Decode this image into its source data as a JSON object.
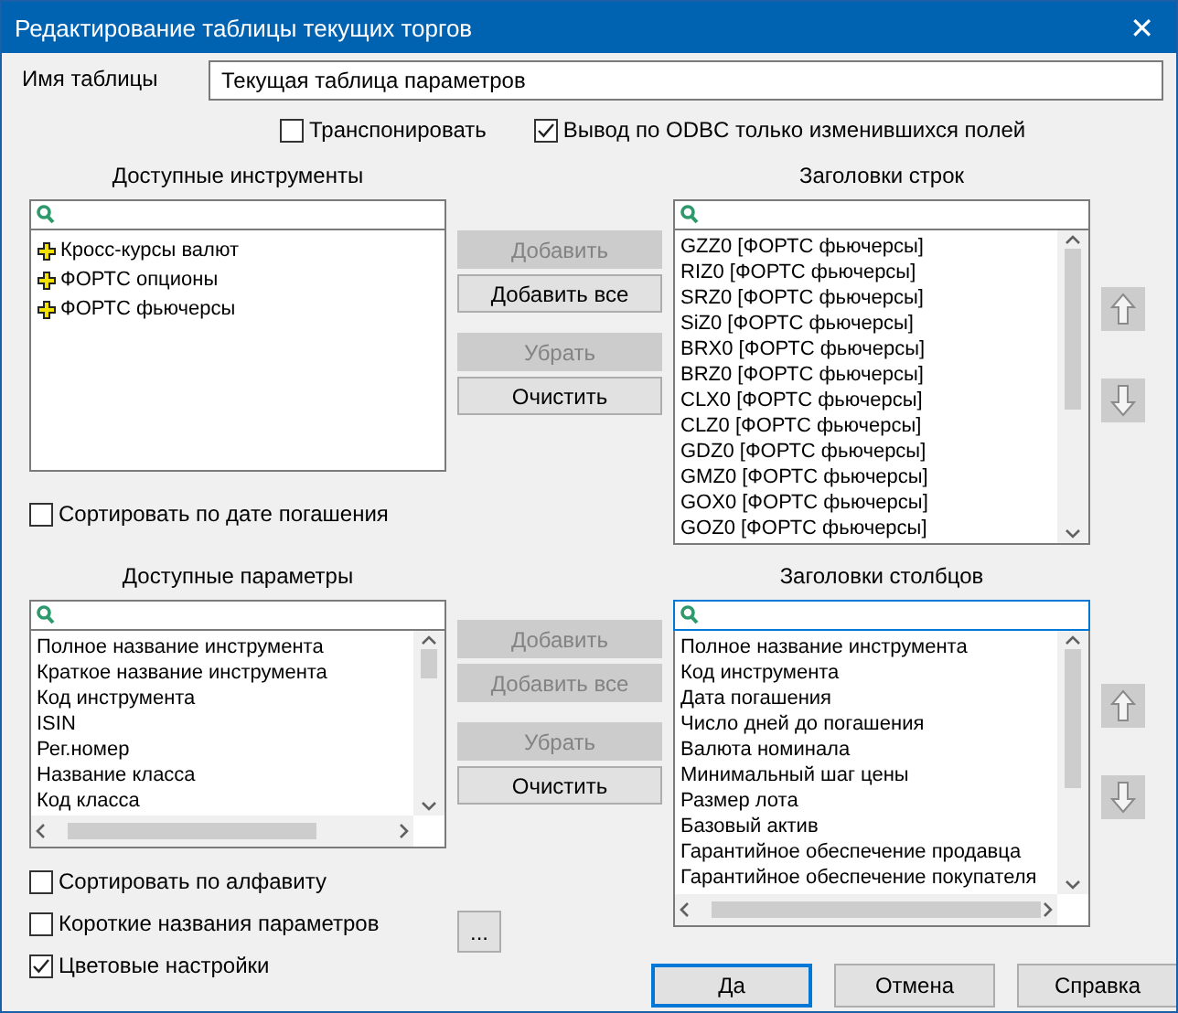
{
  "window": {
    "title": "Редактирование таблицы текущих торгов",
    "close": "✕"
  },
  "table_name": {
    "label": "Имя таблицы",
    "value": "Текущая таблица параметров"
  },
  "options": [
    {
      "label": "Транспонировать",
      "checked": false
    },
    {
      "label": "Вывод по ODBC только изменившихся  полей",
      "checked": true
    }
  ],
  "instruments": {
    "title": "Доступные инструменты",
    "items": [
      {
        "label": "Кросс-курсы валют",
        "expanded": false
      },
      {
        "label": "ФОРТС опционы",
        "expanded": false
      },
      {
        "label": "ФОРТС фьючерсы",
        "expanded": false
      }
    ],
    "sort": {
      "label": "Сортировать по дате погашения",
      "checked": false
    }
  },
  "instrument_buttons": [
    {
      "label": "Добавить",
      "disabled": true
    },
    {
      "label": "Добавить все",
      "disabled": false
    },
    {
      "label": "Убрать",
      "disabled": true
    },
    {
      "label": "Очистить",
      "disabled": false
    }
  ],
  "row_headers": {
    "title": "Заголовки строк",
    "items": [
      "GZZ0 [ФОРТС фьючерсы]",
      "RIZ0 [ФОРТС фьючерсы]",
      "SRZ0 [ФОРТС фьючерсы]",
      "SiZ0 [ФОРТС фьючерсы]",
      "BRX0 [ФОРТС фьючерсы]",
      "BRZ0 [ФОРТС фьючерсы]",
      "CLX0 [ФОРТС фьючерсы]",
      "CLZ0 [ФОРТС фьючерсы]",
      "GDZ0 [ФОРТС фьючерсы]",
      "GMZ0 [ФОРТС фьючерсы]",
      "GOX0 [ФОРТС фьючерсы]",
      "GOZ0 [ФОРТС фьючерсы]"
    ]
  },
  "parameters": {
    "title": "Доступные параметры",
    "items": [
      "Полное название инструмента",
      "Краткое название инструмента",
      "Код инструмента",
      "ISIN",
      "Рег.номер",
      "Название класса",
      "Код класса"
    ]
  },
  "parameter_buttons": [
    {
      "label": "Добавить",
      "disabled": true
    },
    {
      "label": "Добавить все",
      "disabled": true
    },
    {
      "label": "Убрать",
      "disabled": true
    },
    {
      "label": "Очистить",
      "disabled": false
    }
  ],
  "column_headers": {
    "title": "Заголовки столбцов",
    "items": [
      "Полное название инструмента",
      "Код инструмента",
      "Дата погашения",
      "Число дней до погашения",
      "Валюта номинала",
      "Минимальный шаг цены",
      "Размер лота",
      "Базовый актив",
      "Гарантийное обеспечение продавца",
      "Гарантийное обеспечение покупателя"
    ]
  },
  "settings": [
    {
      "label": "Сортировать по алфавиту",
      "checked": false
    },
    {
      "label": "Короткие названия параметров",
      "checked": false
    },
    {
      "label": "Цветовые настройки",
      "checked": true
    }
  ],
  "more_button": "...",
  "footer_buttons": [
    {
      "label": "Да",
      "default": true
    },
    {
      "label": "Отмена",
      "default": false
    },
    {
      "label": "Справка",
      "default": false
    }
  ]
}
